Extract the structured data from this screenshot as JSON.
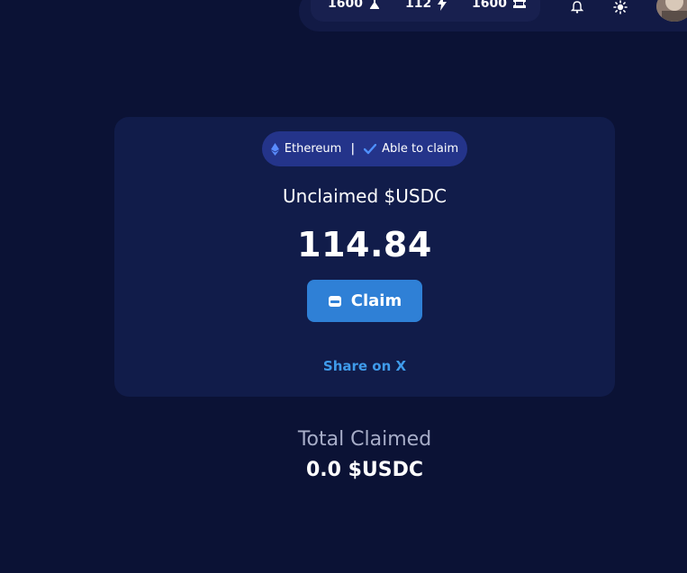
{
  "header": {
    "stats": [
      {
        "value": "1600",
        "icon": "flask-icon"
      },
      {
        "value": "112",
        "icon": "lightning-icon"
      },
      {
        "value": "1600",
        "icon": "ticket-icon"
      }
    ],
    "icons": [
      "bell-icon",
      "sun-icon",
      "avatar"
    ]
  },
  "card": {
    "network": "Ethereum",
    "separator": "|",
    "status": "Able to claim",
    "title": "Unclaimed $USDC",
    "amount": "114.84",
    "claim_label": "Claim",
    "share_label": "Share on X"
  },
  "summary": {
    "total_label": "Total Claimed",
    "total_value": "0.0 $USDC"
  },
  "colors": {
    "background": "#0b1235",
    "card": "#111c4a",
    "pill": "#24348a",
    "button": "#2f80d6",
    "link": "#3f9bea"
  }
}
